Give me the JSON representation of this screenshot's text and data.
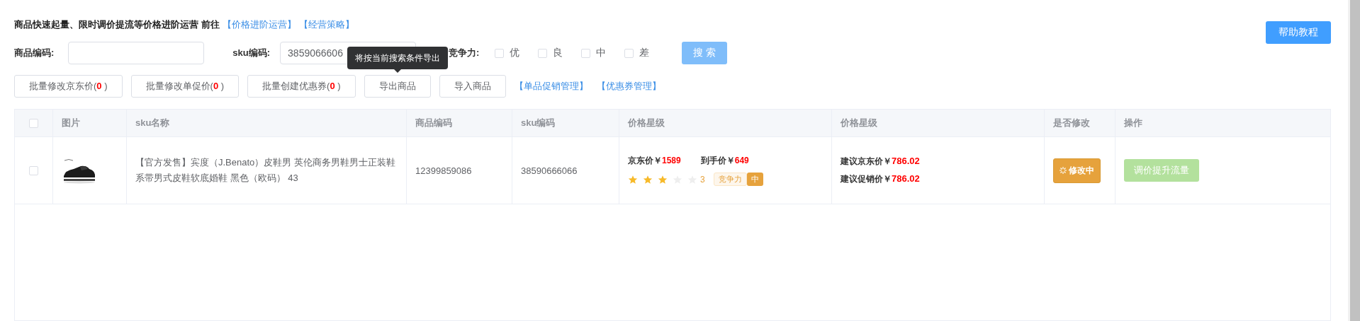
{
  "notice": {
    "text": "商品快速起量、限时调价提流等价格进阶运营 前往",
    "links": [
      "【价格进阶运营】",
      "【经营策略】"
    ]
  },
  "help_button": "帮助教程",
  "filters": {
    "product_code": {
      "label": "商品编码:"
    },
    "sku_code": {
      "label": "sku编码:",
      "value": "3859066606"
    },
    "competitiveness": {
      "label": "竞争力:",
      "options": [
        {
          "label": "优",
          "checked": false
        },
        {
          "label": "良",
          "checked": false
        },
        {
          "label": "中",
          "checked": false
        },
        {
          "label": "差",
          "checked": false
        }
      ]
    },
    "search_button": "搜 索"
  },
  "actions": [
    {
      "kind": "count",
      "label": "批量修改京东价(",
      "count": "0",
      "suffix": ")"
    },
    {
      "kind": "count",
      "label": "批量修改单促价(",
      "count": "0",
      "suffix": ")"
    },
    {
      "kind": "count",
      "label": "批量创建优惠券(",
      "count": "0",
      "suffix": ")"
    },
    {
      "kind": "plain",
      "label": "导出商品",
      "tooltip": "将按当前搜索条件导出"
    },
    {
      "kind": "plain",
      "label": "导入商品"
    }
  ],
  "links": [
    "【单品促销管理】",
    "【优惠券管理】"
  ],
  "table": {
    "all_checked": false,
    "columns": [
      "图片",
      "sku名称",
      "商品编码",
      "sku编码",
      "价格星级",
      "价格星级",
      "是否修改",
      "操作"
    ],
    "rows": [
      {
        "checked": false,
        "sku_name": "【官方发售】宾度（J.Benato）皮鞋男 英伦商务男鞋男士正装鞋系带男式皮鞋软底婚鞋 黑色（欧码） 43",
        "product_code": "12399859086",
        "sku_code": "38590666066",
        "price": {
          "jd_label": "京东价￥",
          "jd_value": "1589",
          "final_label": "到手价￥",
          "final_value": "649",
          "stars": 3,
          "star_count": "3",
          "badge_label": "竞争力",
          "badge_value": "中"
        },
        "suggested": [
          {
            "label": "建议京东价￥",
            "value": "786.02"
          },
          {
            "label": "建议促销价￥",
            "value": "786.02"
          }
        ],
        "status": "修改中",
        "operation": {
          "label": "调价提升流量",
          "disabled": true
        }
      }
    ]
  }
}
